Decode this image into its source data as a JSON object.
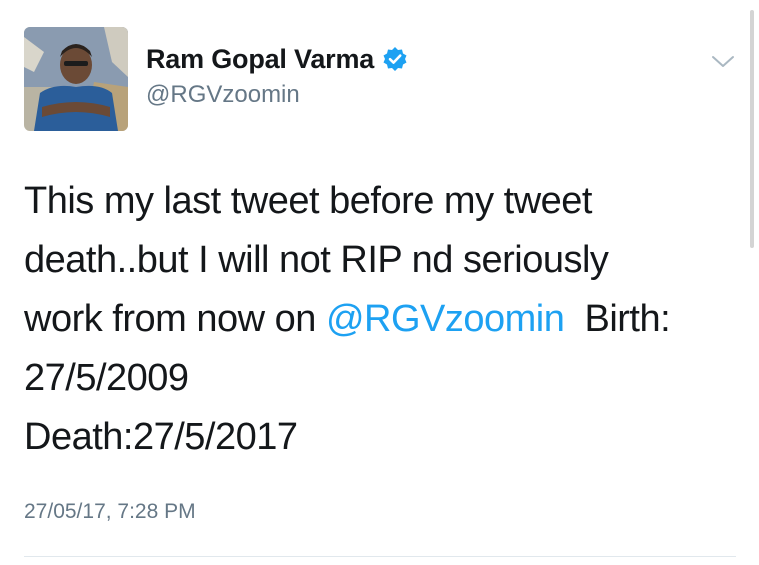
{
  "author": {
    "display_name": "Ram Gopal Varma",
    "handle": "@RGVzoomin",
    "verified": true,
    "avatar_icon": "profile-photo-avatar"
  },
  "tweet": {
    "line1": "This my last tweet before my tweet",
    "line2": "death..but I will not RIP nd seriously",
    "line3_prefix": "work from now on ",
    "line3_mention": "@RGVzoomin",
    "line3_suffix": "  Birth:",
    "line4": "27/5/2009",
    "line5": "Death:27/5/2017"
  },
  "timestamp": "27/05/17, 7:28 PM",
  "menu_icon": "chevron-down-icon",
  "colors": {
    "text": "#14171a",
    "secondary": "#657786",
    "link": "#1da1f2",
    "verified_badge": "#1da1f2"
  }
}
